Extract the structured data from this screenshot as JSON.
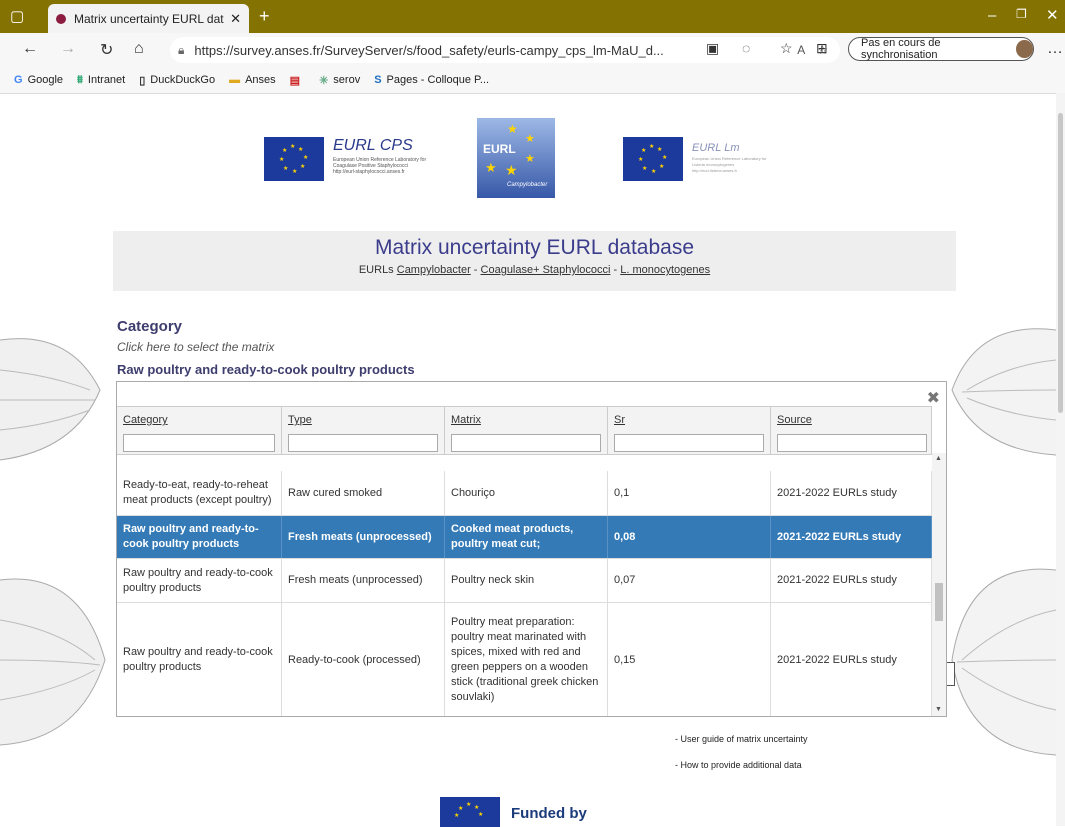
{
  "browser": {
    "tab_title": "Matrix uncertainty EURL databas",
    "url": "https://survey.anses.fr/SurveyServer/s/food_safety/eurls-campy_cps_lm-MaU_d...",
    "sync_label": "Pas en cours de synchronisation",
    "bookmarks": [
      "Google",
      "Intranet",
      "DuckDuckGo",
      "Anses",
      "serov",
      "Pages - Colloque P..."
    ]
  },
  "logos": {
    "cps_title": "EURL CPS",
    "cps_sub1": "European Union Reference Laboratory for",
    "cps_sub2": "Coagulase Positive Staphylococci",
    "cps_sub3": "http://eurl-staphylococci.anses.fr",
    "campy_title": "EURL",
    "campy_sub": "Campylobacter",
    "lm_title": "EURL Lm",
    "lm_sub1": "European Union Reference Laboratory for",
    "lm_sub2": "Listeria monocytogenes",
    "lm_sub3": "http://eurl-listeria.anses.fr"
  },
  "header": {
    "title": "Matrix uncertainty EURL database",
    "sub_prefix": "EURLs ",
    "link1": "Campylobacter",
    "sep1": " - ",
    "link2": "Coagulase+ Staphylococci",
    "sep2": " - ",
    "link3": "L. monocytogenes"
  },
  "category": {
    "heading": "Category",
    "hint": "Click here to select the matrix",
    "selected": "Raw poultry and ready-to-cook poultry products"
  },
  "grid": {
    "columns": [
      "Category",
      "Type",
      "Matrix",
      "Sr",
      "Source"
    ],
    "rows": [
      {
        "category": "Ready-to-eat, ready-to-reheat meat products (except poultry)",
        "type": "Raw cured smoked",
        "matrix": "Chouriço",
        "sr": "0,1",
        "source": "2021-2022 EURLs study"
      },
      {
        "category": "Raw poultry and ready-to-cook poultry products",
        "type": "Fresh meats (unprocessed)",
        "matrix": "Cooked meat products, poultry meat cut;",
        "sr": "0,08",
        "source": "2021-2022 EURLs study"
      },
      {
        "category": "Raw poultry and ready-to-cook poultry products",
        "type": "Fresh meats (unprocessed)",
        "matrix": "Poultry neck skin",
        "sr": "0,07",
        "source": "2021-2022 EURLs study"
      },
      {
        "category": "Raw poultry and ready-to-cook poultry products",
        "type": "Ready-to-cook (processed)",
        "matrix": "Poultry meat preparation: poultry meat marinated with spices, mixed with red and green peppers on a wooden stick (traditional greek chicken souvlaki)",
        "sr": "0,15",
        "source": "2021-2022 EURLs study"
      }
    ]
  },
  "links": {
    "guide": "- User guide of matrix uncertainty",
    "provide": "- How to provide additional data"
  },
  "footer": {
    "funded": "Funded by"
  }
}
